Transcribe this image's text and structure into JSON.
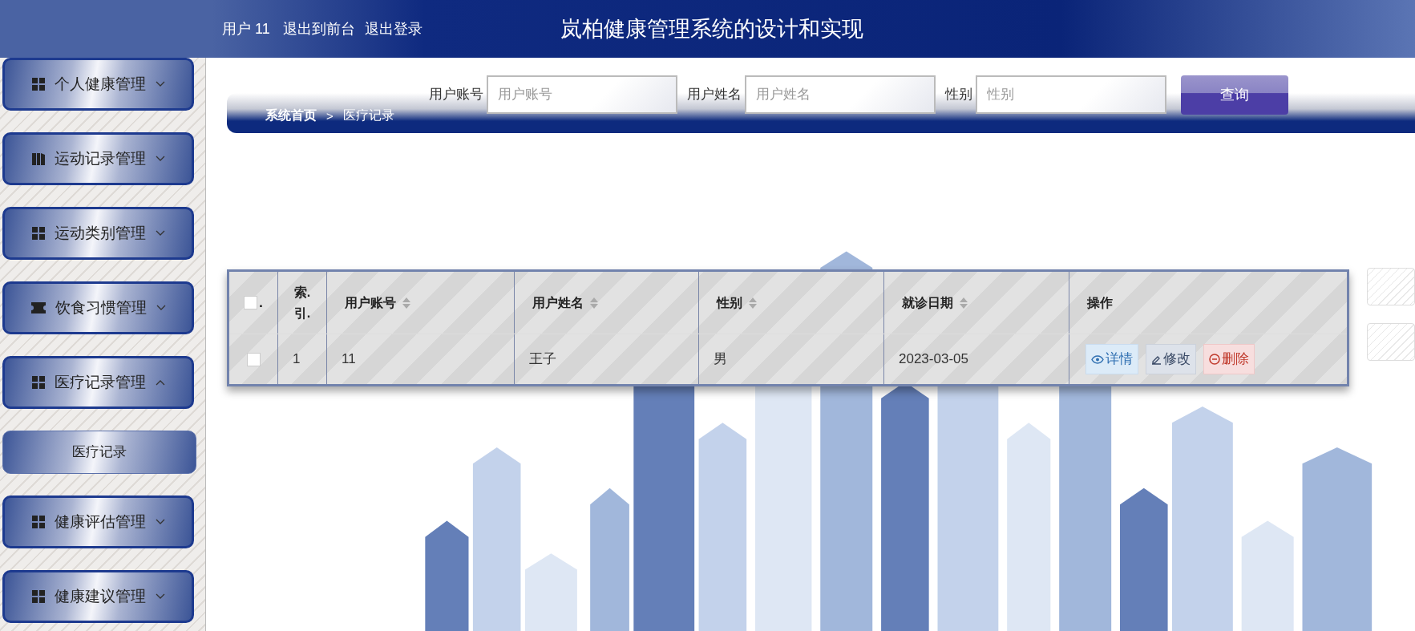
{
  "header": {
    "user_label": "用户 11",
    "links": [
      "退出到前台",
      "退出登录"
    ],
    "title": "岚柏健康管理系统的设计和实现"
  },
  "sidebar": {
    "items": [
      {
        "label": "个人健康管理",
        "kind": "grid",
        "expanded": false
      },
      {
        "label": "运动记录管理",
        "kind": "book",
        "expanded": false
      },
      {
        "label": "运动类别管理",
        "kind": "grid",
        "expanded": false
      },
      {
        "label": "饮食习惯管理",
        "kind": "ticket",
        "expanded": false
      },
      {
        "label": "医疗记录管理",
        "kind": "grid",
        "expanded": true,
        "children": [
          {
            "label": "医疗记录"
          }
        ]
      },
      {
        "label": "健康评估管理",
        "kind": "grid",
        "expanded": false
      },
      {
        "label": "健康建议管理",
        "kind": "grid",
        "expanded": false
      }
    ]
  },
  "search": {
    "fields": [
      {
        "label": "用户账号",
        "placeholder": "用户账号"
      },
      {
        "label": "用户姓名",
        "placeholder": "用户姓名"
      },
      {
        "label": "性别",
        "placeholder": "性别"
      }
    ],
    "button": "查询"
  },
  "breadcrumb": {
    "items": [
      "系统首页",
      "医疗记录"
    ],
    "separator": ">"
  },
  "table": {
    "select_all": {
      "checked": false,
      "mark": "."
    },
    "columns": [
      {
        "label": "索. 引.",
        "sortable": false
      },
      {
        "label": "用户账号",
        "sortable": true
      },
      {
        "label": "用户姓名",
        "sortable": true
      },
      {
        "label": "性别",
        "sortable": true
      },
      {
        "label": "就诊日期",
        "sortable": true
      },
      {
        "label": "操作",
        "sortable": false
      }
    ],
    "rows": [
      {
        "selected": false,
        "cells": [
          "1",
          "11",
          "王子",
          "男",
          "2023-03-05"
        ],
        "actions": [
          {
            "kind": "view",
            "label": "详情"
          },
          {
            "kind": "edit",
            "label": "修改"
          },
          {
            "kind": "delete",
            "label": "删除"
          }
        ]
      }
    ]
  }
}
